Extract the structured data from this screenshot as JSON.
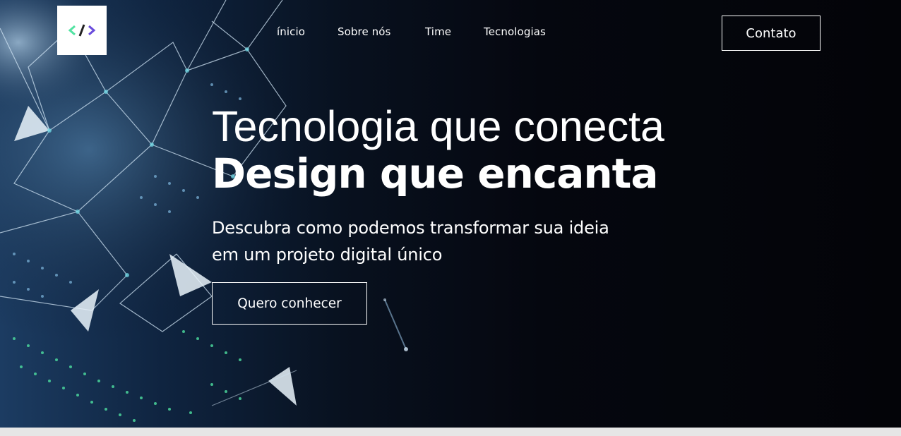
{
  "header": {
    "logo_icon": "code-brackets-icon",
    "nav": [
      "ínicio",
      "Sobre nós",
      "Time",
      "Tecnologias"
    ],
    "contact_label": "Contato"
  },
  "hero": {
    "title_line1": "Tecnologia que conecta",
    "title_line2": "Design que encanta",
    "subtitle_line1": "Descubra como podemos transformar sua ideia",
    "subtitle_line2": "em um projeto digital único",
    "cta_label": "Quero conhecer"
  },
  "colors": {
    "text": "#ffffff",
    "hero_dark": "#05070f",
    "hero_blue": "#1c3c62",
    "accent_green": "#52e3a2",
    "accent_purple": "#6a4cdc"
  }
}
